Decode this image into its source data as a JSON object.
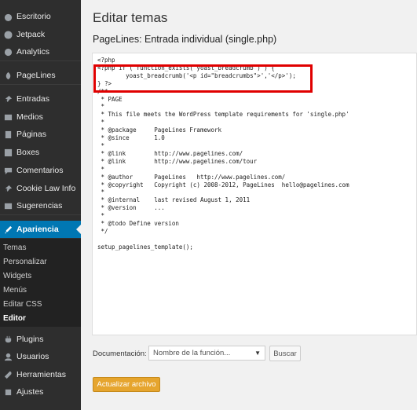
{
  "sidebar": {
    "items": [
      {
        "label": "Escritorio",
        "icon": "dashboard-icon"
      },
      {
        "label": "Jetpack",
        "icon": "jetpack-icon"
      },
      {
        "label": "Analytics",
        "icon": "analytics-icon"
      },
      {
        "label": "PageLines",
        "icon": "pagelines-icon"
      },
      {
        "label": "Entradas",
        "icon": "pin-icon"
      },
      {
        "label": "Medios",
        "icon": "media-icon"
      },
      {
        "label": "Páginas",
        "icon": "pages-icon"
      },
      {
        "label": "Boxes",
        "icon": "boxes-icon"
      },
      {
        "label": "Comentarios",
        "icon": "comments-icon"
      },
      {
        "label": "Cookie Law Info",
        "icon": "pin-icon"
      },
      {
        "label": "Sugerencias",
        "icon": "suggestions-icon"
      },
      {
        "label": "Apariencia",
        "icon": "appearance-icon"
      },
      {
        "label": "Plugins",
        "icon": "plugins-icon"
      },
      {
        "label": "Usuarios",
        "icon": "users-icon"
      },
      {
        "label": "Herramientas",
        "icon": "tools-icon"
      },
      {
        "label": "Ajustes",
        "icon": "settings-icon"
      }
    ],
    "submenu": [
      "Temas",
      "Personalizar",
      "Widgets",
      "Menús",
      "Editar CSS",
      "Editor"
    ]
  },
  "main": {
    "title": "Editar temas",
    "file_title": "PageLines: Entrada individual (single.php)",
    "code": [
      "<?php",
      "<?php if ( function_exists( yoast_breadcrumb ) ) {",
      "        yoast_breadcrumb('<p id=\"breadcrumbs\">','</p>');",
      "} ?>",
      "/**",
      " * PAGE",
      " *",
      " * This file meets the WordPress template requirements for 'single.php'",
      " *",
      " * @package     PageLines Framework",
      " * @since       1.0",
      " *",
      " * @link        http://www.pagelines.com/",
      " * @link        http://www.pagelines.com/tour",
      " *",
      " * @author      PageLines   http://www.pagelines.com/",
      " * @copyright   Copyright (c) 2008-2012, PageLines  hello@pagelines.com",
      " *",
      " * @internal    last revised August 1, 2011",
      " * @version     ...",
      " *",
      " * @todo Define version",
      " */",
      "",
      "setup_pagelines_template();"
    ],
    "doc_label": "Documentación:",
    "doc_select": "Nombre de la función...",
    "search_button": "Buscar",
    "update_button": "Actualizar archivo"
  },
  "colors": {
    "accent": "#0077b3",
    "sidebar": "#2e2e2e",
    "update": "#e6a52e",
    "highlight": "#e00000"
  }
}
